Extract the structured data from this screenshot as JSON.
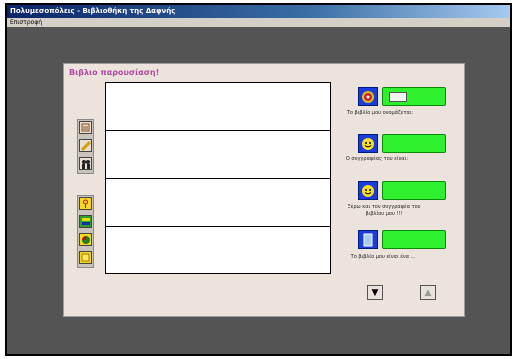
{
  "window": {
    "title": "Πολυμεσοπόλεις - Βιβλιοθήκη της Δαφνής",
    "menu": [
      "Επιστροφή"
    ]
  },
  "panel": {
    "title": "Βιβλιο παρουσίαση!"
  },
  "list_rows": [
    "",
    "",
    "",
    ""
  ],
  "toolbar_icons": [
    "list-icon",
    "pencil-icon",
    "people-icon",
    "key-icon",
    "book-stack-icon",
    "chart-icon",
    "note-icon"
  ],
  "fields": [
    {
      "icon": "cd-icon",
      "green_icon": "book-icon",
      "caption": "Το βιβλίο μου ονομάζεται:"
    },
    {
      "icon": "smiley-icon",
      "caption": "Ο συγγραφέας του είναι:"
    },
    {
      "icon": "smiley-icon",
      "caption": "Ξέρω και τον συγγραφέα του βιβλίου μου !!!"
    },
    {
      "icon": "page-icon",
      "caption": "Το βιβλίο μου είναι ένα ..."
    }
  ],
  "nav": {
    "down": "▼",
    "up": "▲"
  },
  "colors": {
    "accent_title": "#b04aa0",
    "green": "#2ef02e",
    "icon_blue": "#1a3cd8"
  }
}
